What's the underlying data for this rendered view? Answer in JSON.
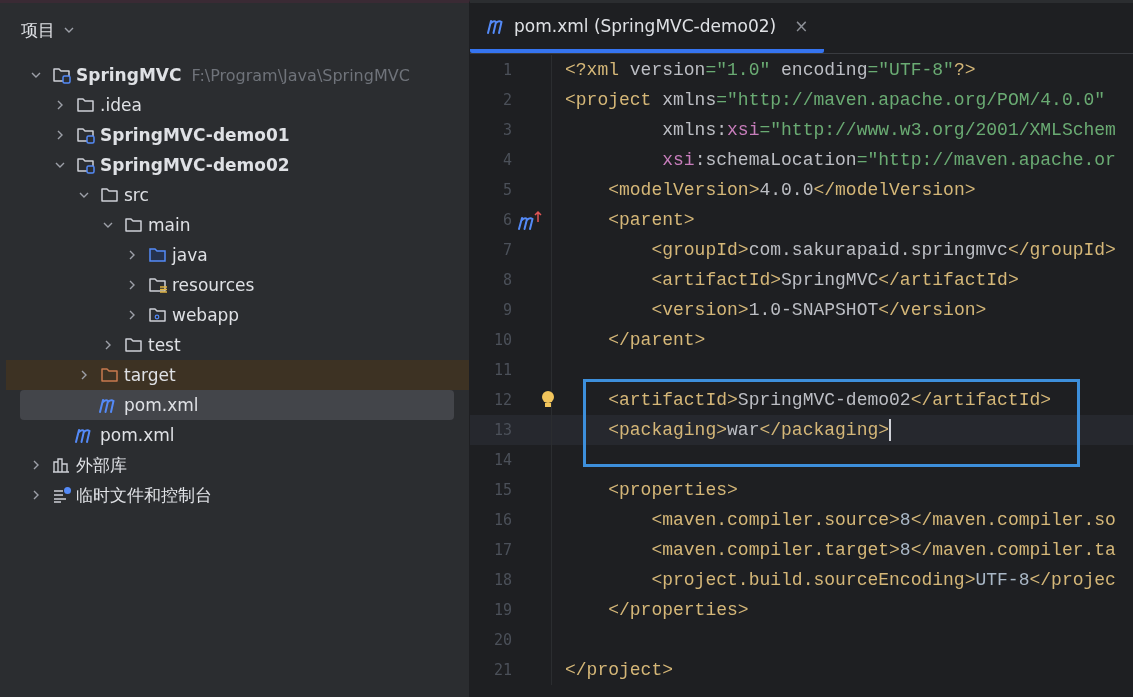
{
  "project_panel": {
    "title": "项目",
    "tree": [
      {
        "label": "SpringMVC",
        "hint": "F:\\Program\\Java\\SpringMVC",
        "kind": "module",
        "bold": true,
        "expanded": true,
        "selected": false,
        "children": [
          {
            "label": ".idea",
            "kind": "folder",
            "expanded": false,
            "selected": false
          },
          {
            "label": "SpringMVC-demo01",
            "kind": "module",
            "bold": true,
            "expanded": false,
            "selected": false
          },
          {
            "label": "SpringMVC-demo02",
            "kind": "module",
            "bold": true,
            "expanded": true,
            "selected": false,
            "children": [
              {
                "label": "src",
                "kind": "folder",
                "expanded": true,
                "selected": false,
                "children": [
                  {
                    "label": "main",
                    "kind": "folder",
                    "expanded": true,
                    "selected": false,
                    "children": [
                      {
                        "label": "java",
                        "kind": "source",
                        "expanded": false,
                        "selected": false
                      },
                      {
                        "label": "resources",
                        "kind": "resources",
                        "expanded": false,
                        "selected": false
                      },
                      {
                        "label": "webapp",
                        "kind": "web",
                        "expanded": false,
                        "selected": false
                      }
                    ]
                  },
                  {
                    "label": "test",
                    "kind": "folder",
                    "expanded": false,
                    "selected": false
                  }
                ]
              },
              {
                "label": "target",
                "kind": "excluded",
                "expanded": false,
                "selected": false
              },
              {
                "label": "pom.xml",
                "kind": "maven",
                "selected": true
              }
            ]
          },
          {
            "label": "pom.xml",
            "kind": "maven",
            "selected": false
          }
        ]
      },
      {
        "label": "外部库",
        "kind": "library",
        "expanded": false,
        "selected": false
      },
      {
        "label": "临时文件和控制台",
        "kind": "scratches",
        "expanded": false,
        "selected": false
      }
    ]
  },
  "editor": {
    "tabs": [
      {
        "label": "pom.xml (SpringMVC-demo02)",
        "close": "×",
        "selected": true
      }
    ],
    "lines": [
      {
        "number": "1",
        "segments": [
          {
            "kind": "tag",
            "text": "<?xml "
          },
          {
            "kind": "attr",
            "text": "version"
          },
          {
            "kind": "str",
            "text": "=\"1.0\" "
          },
          {
            "kind": "attr",
            "text": "encoding"
          },
          {
            "kind": "str",
            "text": "=\"UTF-8\""
          },
          {
            "kind": "tag",
            "text": "?>"
          }
        ]
      },
      {
        "number": "2",
        "segments": [
          {
            "kind": "tag",
            "text": "<project "
          },
          {
            "kind": "attr",
            "text": "xmlns"
          },
          {
            "kind": "str",
            "text": "=\"http://maven.apache.org/POM/4.0.0\""
          }
        ]
      },
      {
        "number": "3",
        "segments": [
          {
            "kind": "attr",
            "text": "         xmlns:"
          },
          {
            "kind": "ns",
            "text": "xsi"
          },
          {
            "kind": "str",
            "text": "=\"http://www.w3.org/2001/XMLSchem"
          }
        ]
      },
      {
        "number": "4",
        "segments": [
          {
            "kind": "ns",
            "text": "         xsi"
          },
          {
            "kind": "attr",
            "text": ":schemaLocation"
          },
          {
            "kind": "str",
            "text": "=\"http://maven.apache.or"
          }
        ]
      },
      {
        "number": "5",
        "segments": [
          {
            "kind": "tag",
            "text": "    <modelVersion>"
          },
          {
            "kind": "text",
            "text": "4.0.0"
          },
          {
            "kind": "tag",
            "text": "</modelVersion>"
          }
        ]
      },
      {
        "number": "6",
        "overrides_parent": true,
        "segments": [
          {
            "kind": "tag",
            "text": "    <parent>"
          }
        ]
      },
      {
        "number": "7",
        "segments": [
          {
            "kind": "tag",
            "text": "        <groupId>"
          },
          {
            "kind": "text",
            "text": "com.sakurapaid.springmvc"
          },
          {
            "kind": "tag",
            "text": "</groupId>"
          }
        ]
      },
      {
        "number": "8",
        "segments": [
          {
            "kind": "tag",
            "text": "        <artifactId>"
          },
          {
            "kind": "text",
            "text": "SpringMVC"
          },
          {
            "kind": "tag",
            "text": "</artifactId>"
          }
        ]
      },
      {
        "number": "9",
        "segments": [
          {
            "kind": "tag",
            "text": "        <version>"
          },
          {
            "kind": "text",
            "text": "1.0-SNAPSHOT"
          },
          {
            "kind": "tag",
            "text": "</version>"
          }
        ]
      },
      {
        "number": "10",
        "segments": [
          {
            "kind": "tag",
            "text": "    </parent>"
          }
        ]
      },
      {
        "number": "11"
      },
      {
        "number": "12",
        "has_intention": true,
        "boxed": true,
        "segments": [
          {
            "kind": "tag",
            "text": "    <artifactId>"
          },
          {
            "kind": "text",
            "text": "SpringMVC-demo02"
          },
          {
            "kind": "tag",
            "text": "</artifactId>"
          }
        ]
      },
      {
        "number": "13",
        "current": true,
        "boxed": true,
        "segments": [
          {
            "kind": "tag",
            "text": "    <packaging>"
          },
          {
            "kind": "text",
            "text": "war"
          },
          {
            "kind": "tag",
            "text": "</packaging>"
          }
        ]
      },
      {
        "number": "14"
      },
      {
        "number": "15",
        "segments": [
          {
            "kind": "tag",
            "text": "    <properties>"
          }
        ]
      },
      {
        "number": "16",
        "segments": [
          {
            "kind": "tag",
            "text": "        <maven.compiler.source>"
          },
          {
            "kind": "num",
            "text": "8"
          },
          {
            "kind": "tag",
            "text": "</maven.compiler.so"
          }
        ]
      },
      {
        "number": "17",
        "segments": [
          {
            "kind": "tag",
            "text": "        <maven.compiler.target>"
          },
          {
            "kind": "num",
            "text": "8"
          },
          {
            "kind": "tag",
            "text": "</maven.compiler.ta"
          }
        ]
      },
      {
        "number": "18",
        "segments": [
          {
            "kind": "tag",
            "text": "        <project.build.sourceEncoding>"
          },
          {
            "kind": "num",
            "text": "UTF-8"
          },
          {
            "kind": "tag",
            "text": "</projec"
          }
        ]
      },
      {
        "number": "19",
        "segments": [
          {
            "kind": "tag",
            "text": "    </properties>"
          }
        ]
      },
      {
        "number": "20"
      },
      {
        "number": "21",
        "segments": [
          {
            "kind": "tag",
            "text": "</project>"
          }
        ]
      }
    ]
  }
}
